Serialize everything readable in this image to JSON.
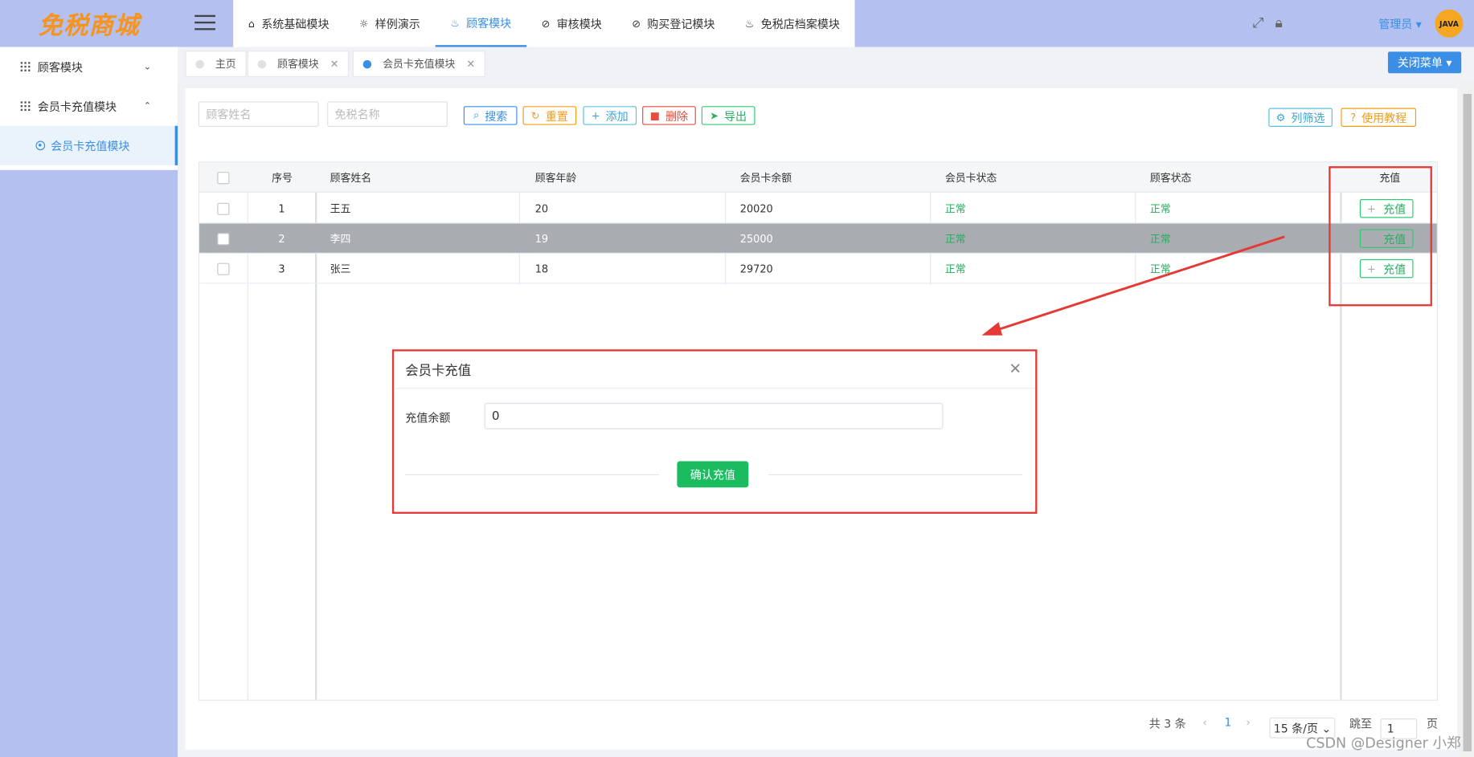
{
  "logo": {
    "text": "免税商城"
  },
  "sidebar": {
    "items": [
      {
        "label": "顾客模块",
        "chevron": "⌄"
      },
      {
        "label": "会员卡充值模块",
        "chevron": "⌃"
      }
    ],
    "sub_item": {
      "label": "会员卡充值模块"
    }
  },
  "topnav": {
    "items": [
      {
        "label": "系统基础模块",
        "icon": "⌂"
      },
      {
        "label": "样例演示",
        "icon": "☼"
      },
      {
        "label": "顾客模块",
        "icon": "♨"
      },
      {
        "label": "审核模块",
        "icon": "⊘"
      },
      {
        "label": "购买登记模块",
        "icon": "⊘"
      },
      {
        "label": "免税店档案模块",
        "icon": "♨"
      }
    ],
    "admin_label": "管理员 ▾",
    "avatar_text": "JAVA"
  },
  "tabs": [
    {
      "label": "主页",
      "close": ""
    },
    {
      "label": "顾客模块",
      "close": "✕"
    },
    {
      "label": "会员卡充值模块",
      "close": "✕"
    }
  ],
  "close_menu_label": "关闭菜单 ▾",
  "search": {
    "name_placeholder": "顾客姓名",
    "shop_placeholder": "免税名称"
  },
  "toolbar": {
    "search": "搜索",
    "reset": "重置",
    "add": "添加",
    "delete": "删除",
    "export": "导出",
    "column_filter": "列筛选",
    "tutorial": "使用教程"
  },
  "table": {
    "headers": [
      "序号",
      "顾客姓名",
      "顾客年龄",
      "会员卡余额",
      "会员卡状态",
      "顾客状态",
      "充值"
    ],
    "rows": [
      {
        "no": "1",
        "name": "王五",
        "age": "20",
        "balance": "20020",
        "card_status": "正常",
        "customer_status": "正常",
        "action": "充值"
      },
      {
        "no": "2",
        "name": "李四",
        "age": "19",
        "balance": "25000",
        "card_status": "正常",
        "customer_status": "正常",
        "action": "充值"
      },
      {
        "no": "3",
        "name": "张三",
        "age": "18",
        "balance": "29720",
        "card_status": "正常",
        "customer_status": "正常",
        "action": "充值"
      }
    ]
  },
  "pagination": {
    "total": "共 3 条",
    "current_page": "1",
    "page_size": "15 条/页 ⌄",
    "jump_label": "跳至",
    "jump_value": "1",
    "page_suffix": "页"
  },
  "modal": {
    "title": "会员卡充值",
    "field_label": "充值余额",
    "field_value": "0",
    "confirm": "确认充值"
  },
  "watermark": "CSDN @Designer 小郑",
  "colors": {
    "accent": "#3a8ee6",
    "sidebar": "#b3c0f0",
    "success": "#1bbc5f",
    "highlight": "#e53935"
  }
}
